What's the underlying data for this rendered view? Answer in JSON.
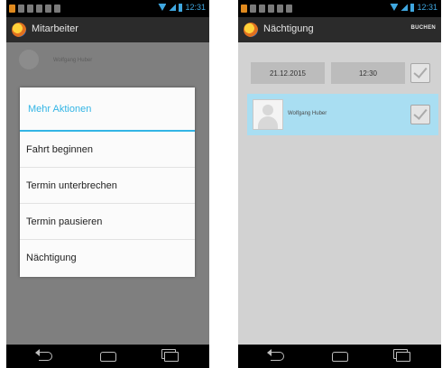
{
  "left_screen": {
    "statusbar": {
      "time": "12:31"
    },
    "actionbar": {
      "title": "Mitarbeiter"
    },
    "background_user": {
      "name": "Wolfgang Huber"
    },
    "dialog": {
      "title": "Mehr Aktionen",
      "items": [
        {
          "label": "Fahrt beginnen"
        },
        {
          "label": "Termin unterbrechen"
        },
        {
          "label": "Termin pausieren"
        },
        {
          "label": "Nächtigung"
        }
      ]
    }
  },
  "right_screen": {
    "statusbar": {
      "time": "12:31"
    },
    "actionbar": {
      "title": "Nächtigung",
      "action_label": "BUCHEN"
    },
    "date_field": {
      "value": "21.12.2015"
    },
    "time_field": {
      "value": "12:30"
    },
    "date_row_checked": true,
    "user_card": {
      "name": "Wolfgang Huber",
      "checked": true
    }
  },
  "icons": {
    "app_logo": "app-logo-icon",
    "back": "back-icon",
    "home": "home-icon",
    "recent_apps": "recent-apps-icon",
    "checkmark": "checkmark-icon",
    "avatar": "avatar-placeholder-icon"
  },
  "colors": {
    "accent": "#33b5e5",
    "statusbar_icons": "#3fa7e0",
    "selected_row": "#a9def2",
    "actionbar_bg": "#2b2b2b"
  }
}
